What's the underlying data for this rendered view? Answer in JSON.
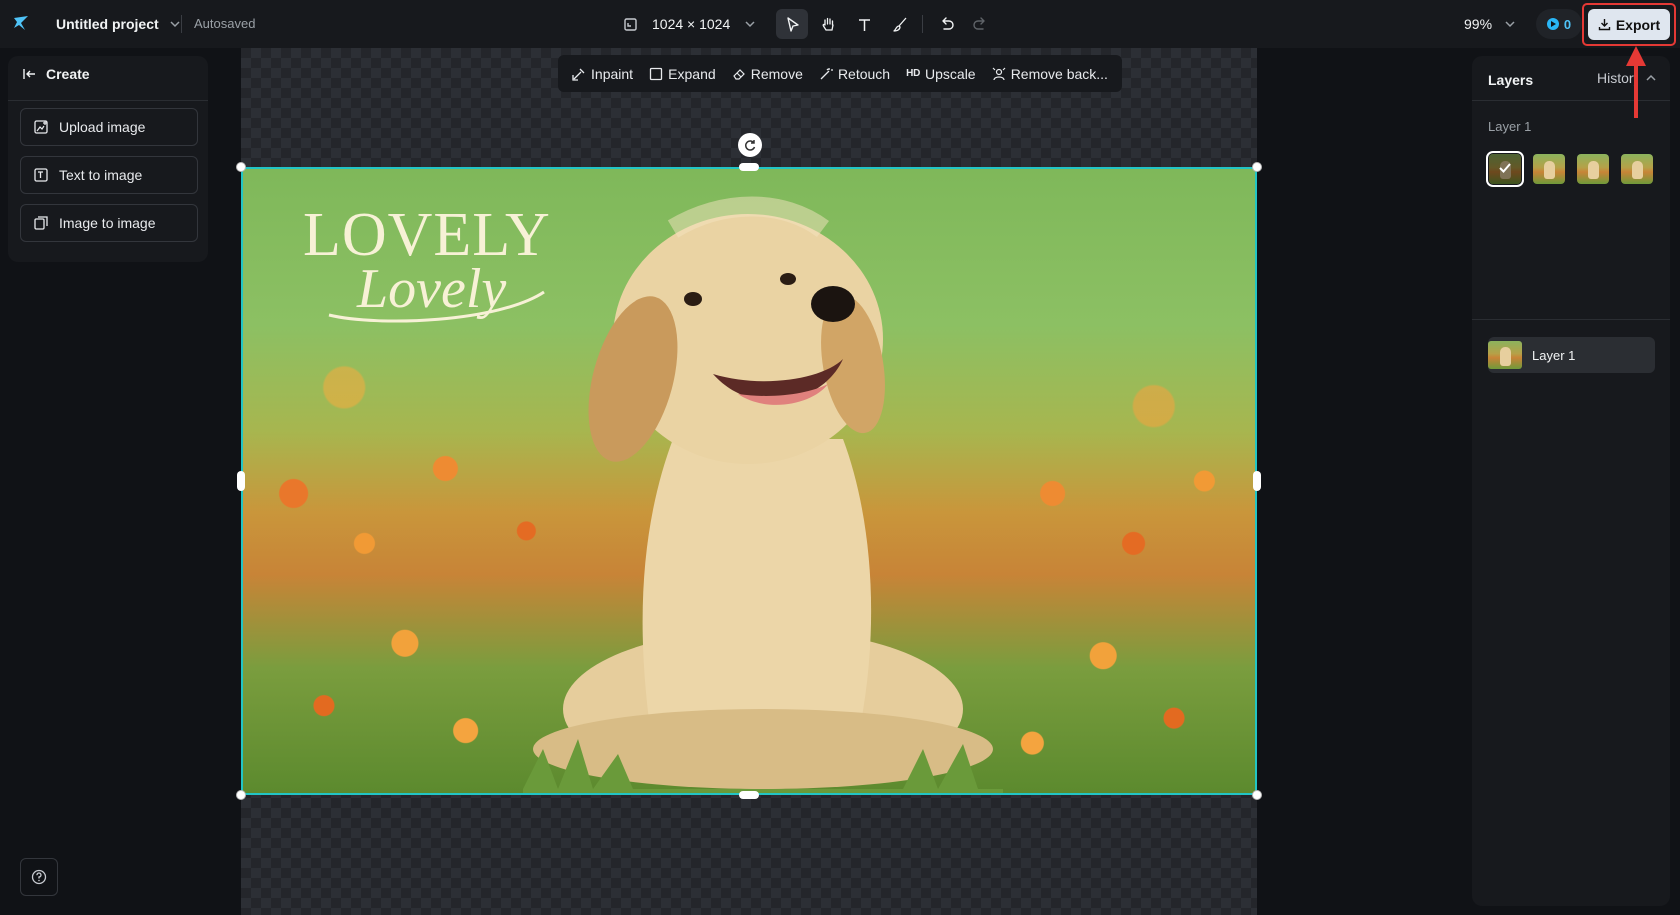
{
  "topbar": {
    "project_name": "Untitled project",
    "autosave_status": "Autosaved",
    "canvas_size": "1024 × 1024",
    "zoom": "99%",
    "credits": "0",
    "export_label": "Export"
  },
  "left_panel": {
    "create_label": "Create",
    "buttons": [
      {
        "label": "Upload image",
        "icon": "upload-image-icon"
      },
      {
        "label": "Text to image",
        "icon": "text-to-image-icon"
      },
      {
        "label": "Image to image",
        "icon": "image-to-image-icon"
      }
    ]
  },
  "canvas_toolbar": {
    "items": [
      {
        "label": "Inpaint",
        "icon": "inpaint-icon"
      },
      {
        "label": "Expand",
        "icon": "expand-icon"
      },
      {
        "label": "Remove",
        "icon": "eraser-icon"
      },
      {
        "label": "Retouch",
        "icon": "magic-wand-icon"
      },
      {
        "label": "Upscale",
        "icon": "hd-icon",
        "badge": "HD"
      },
      {
        "label": "Remove back...",
        "icon": "remove-background-icon"
      }
    ]
  },
  "canvas": {
    "image_text": "LOVELY Lovely"
  },
  "right_panel": {
    "tabs": [
      "Layers",
      "History"
    ],
    "section_label": "Layer 1",
    "thumbnail_count": 4,
    "selected_thumbnail": 0,
    "layers": [
      {
        "name": "Layer 1"
      }
    ]
  },
  "colors": {
    "accent_selection": "#22c5c5",
    "export_button": "#dfe6ef",
    "annotation": "#e53935",
    "credits": "#29b6f6"
  }
}
